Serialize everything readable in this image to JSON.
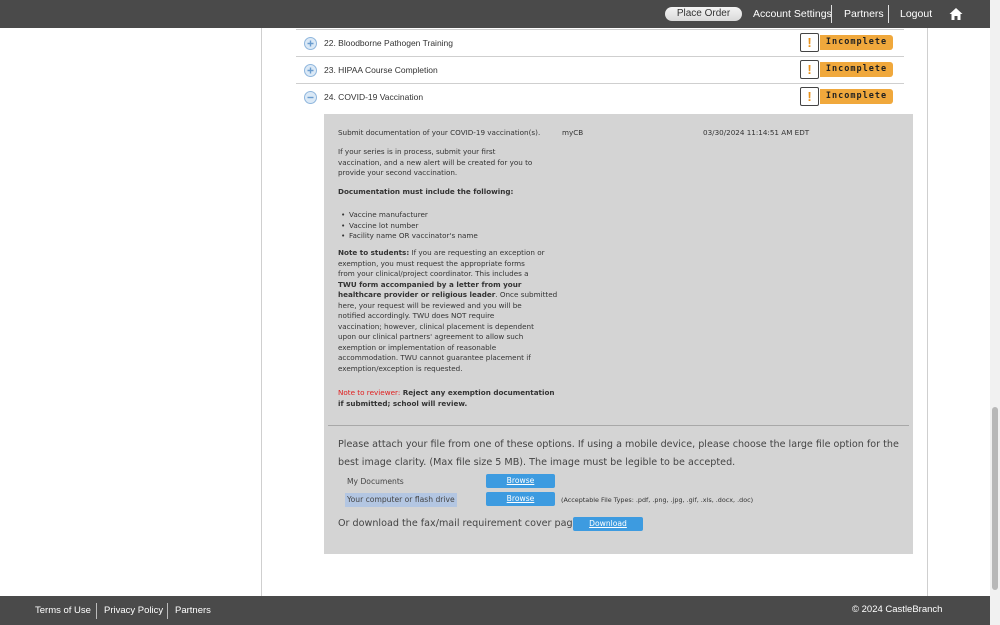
{
  "header": {
    "place_order": "Place Order",
    "account_settings": "Account Settings",
    "partners": "Partners",
    "logout": "Logout",
    "home_icon": "home-icon"
  },
  "requirements": [
    {
      "title": "22. Bloodborne Pathogen Training",
      "status": "Incomplete",
      "expanded": false
    },
    {
      "title": "23. HIPAA Course Completion",
      "status": "Incomplete",
      "expanded": false
    },
    {
      "title": "24. COVID-19 Vaccination",
      "status": "Incomplete",
      "expanded": true
    }
  ],
  "detail": {
    "submit_text": "Submit documentation of your COVID-19 vaccination(s).",
    "source": "myCB",
    "timestamp": "03/30/2024 11:14:51 AM EDT",
    "series_line1": "If your series is in process, submit your first",
    "series_line2": "vaccination, and a new alert will be created for you to",
    "series_line3": "provide your second vaccination.",
    "must_include": "Documentation must include the following:",
    "bullets": [
      "Vaccine manufacturer",
      "Vaccine lot number",
      "Facility name OR vaccinator's name"
    ],
    "note_students_label": "Note to students:",
    "ns1": " If you are requesting an exception or",
    "ns2": "exemption, you must request the appropriate forms",
    "ns3": "from your clinical/project coordinator. This includes a",
    "ns4": "TWU form accompanied by a letter from your",
    "ns5": "healthcare provider or religious leader",
    "ns5b": ". Once submitted",
    "ns6": "here, your request will be reviewed and you will be",
    "ns7": "notified accordingly. TWU does NOT require",
    "ns8": "vaccination; however, clinical placement is dependent",
    "ns9": "upon our clinical partners' agreement to allow such",
    "ns10": "exemption or implementation of reasonable",
    "ns11": "accommodation. TWU cannot guarantee placement if",
    "ns12": "exemption/exception is requested.",
    "note_reviewer_label": "Note to reviewer:",
    "nr1": " Reject any exemption documentation",
    "nr2": "if submitted; school will review."
  },
  "attach": {
    "instructions": "Please attach your file from one of these options. If using a mobile device, please choose the large file option for the best image clarity. (Max file size 5 MB). The image must be legible to be accepted.",
    "my_documents": "My Documents",
    "computer": "Your computer or flash drive",
    "browse": "Browse",
    "file_types": "(Acceptable File Types: .pdf, .png, .jpg, .gif, .xls, .docx, .doc)",
    "download_text": "Or download the fax/mail requirement cover page",
    "download": "Download"
  },
  "footer": {
    "terms": "Terms of Use",
    "privacy": "Privacy Policy",
    "partners": "Partners",
    "copyright": "© 2024 CastleBranch"
  },
  "colors": {
    "bar": "#4a4a4a",
    "status": "#f0a83c",
    "panel": "#d4d4d4",
    "button": "#3d9be0",
    "reviewer_note": "#e02020"
  }
}
